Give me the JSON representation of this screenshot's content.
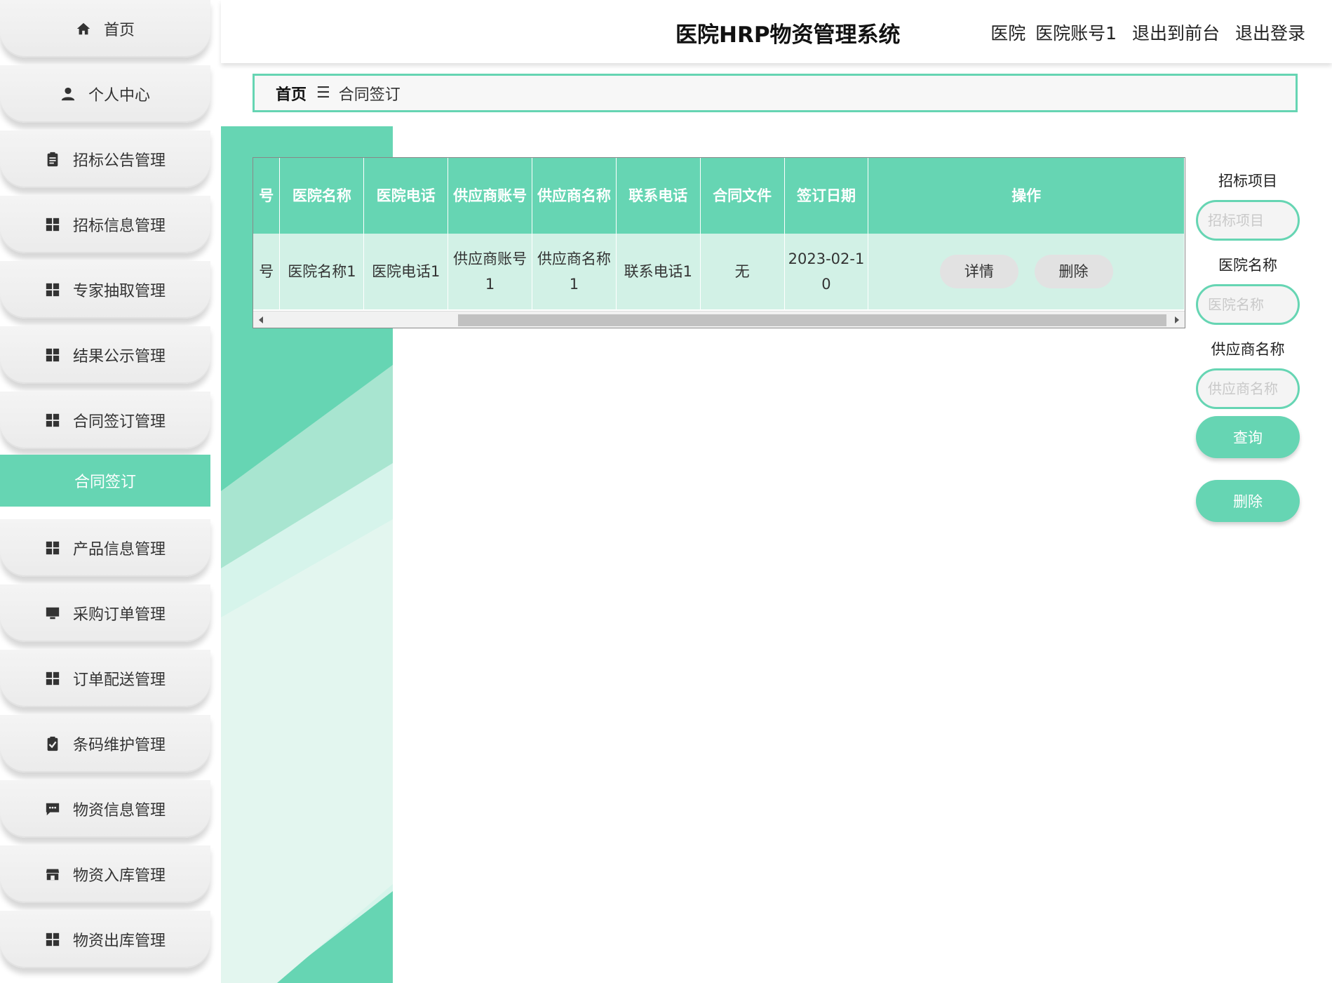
{
  "header": {
    "title": "医院HRP物资管理系统",
    "role": "医院",
    "account": "医院账号1",
    "to_front_label": "退出到前台",
    "logout_label": "退出登录"
  },
  "breadcrumb": {
    "home": "首页",
    "separator": "☰",
    "current": "合同签订"
  },
  "sidebar": {
    "items": [
      {
        "label": "首页",
        "icon": "home-icon"
      },
      {
        "label": "个人中心",
        "icon": "user-icon"
      },
      {
        "label": "招标公告管理",
        "icon": "clipboard-icon"
      },
      {
        "label": "招标信息管理",
        "icon": "grid-icon"
      },
      {
        "label": "专家抽取管理",
        "icon": "grid-icon"
      },
      {
        "label": "结果公示管理",
        "icon": "grid-icon"
      },
      {
        "label": "合同签订管理",
        "icon": "grid-icon"
      },
      {
        "label": "产品信息管理",
        "icon": "grid-icon"
      },
      {
        "label": "采购订单管理",
        "icon": "monitor-icon"
      },
      {
        "label": "订单配送管理",
        "icon": "grid-icon"
      },
      {
        "label": "条码维护管理",
        "icon": "clipboard-check-icon"
      },
      {
        "label": "物资信息管理",
        "icon": "chat-icon"
      },
      {
        "label": "物资入库管理",
        "icon": "store-icon"
      },
      {
        "label": "物资出库管理",
        "icon": "grid-icon"
      }
    ],
    "active_sub": "合同签订"
  },
  "table": {
    "headers": [
      "号",
      "医院名称",
      "医院电话",
      "供应商账号",
      "供应商名称",
      "联系电话",
      "合同文件",
      "签订日期",
      "操作"
    ],
    "rows": [
      {
        "c0": "号",
        "hospital_name": "医院名称1",
        "hospital_phone": "医院电话1",
        "supplier_account": "供应商账号1",
        "supplier_name": "供应商名称1",
        "contact_phone": "联系电话1",
        "contract_file": "无",
        "sign_date": "2023-02-10",
        "detail_label": "详情",
        "delete_label": "删除"
      }
    ]
  },
  "search": {
    "fields": [
      {
        "label": "招标项目",
        "placeholder": "招标项目"
      },
      {
        "label": "医院名称",
        "placeholder": "医院名称"
      },
      {
        "label": "供应商名称",
        "placeholder": "供应商名称"
      }
    ],
    "query_label": "查询",
    "delete_label": "删除"
  },
  "colors": {
    "accent": "#66d5b3",
    "row_bg": "#d2f1e6",
    "sidebar_bg": "#eeeeee"
  }
}
